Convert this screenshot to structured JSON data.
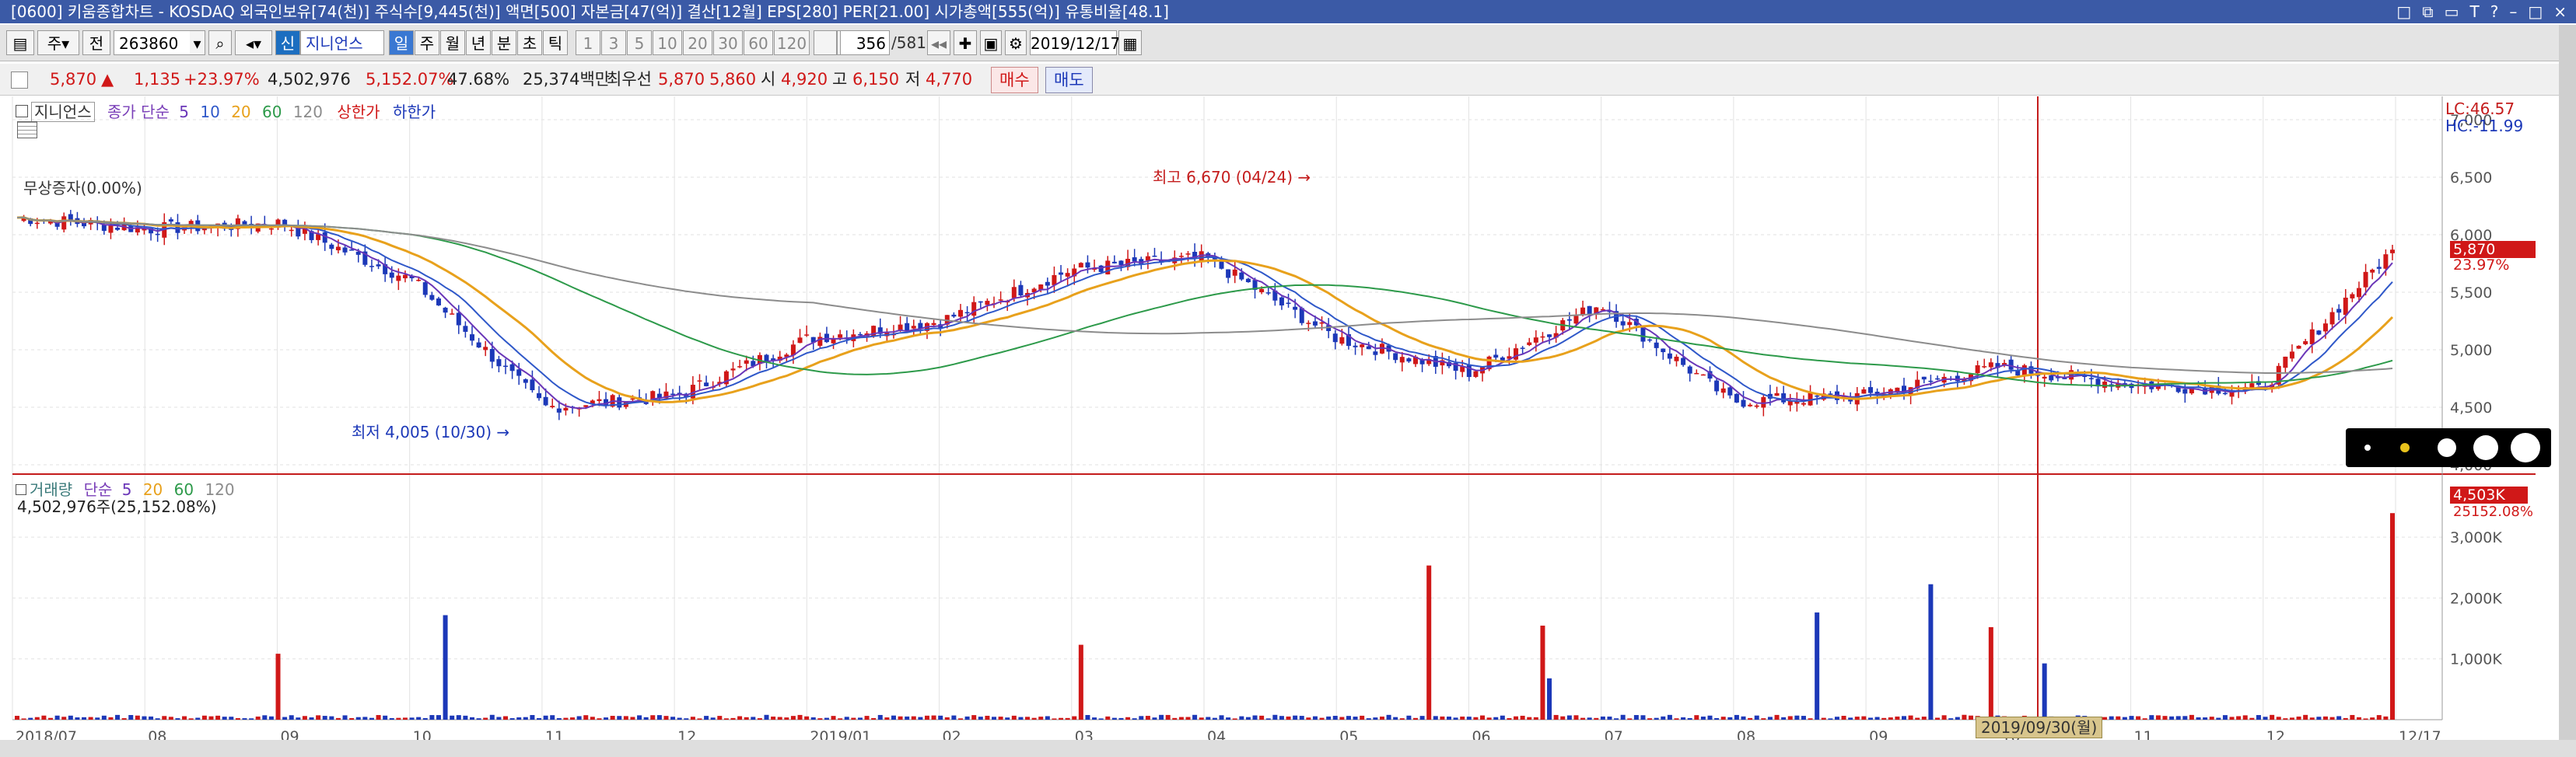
{
  "window": {
    "title": "[0600] 키움종합차트 - KOSDAQ 외국인보유[74(천)] 주식수[9,445(천)] 액면[500] 자본금[47(억)] 결산[12월] EPS[280] PER[21.00] 시가총액[555(억)] 유통비율[48.1]",
    "controls": [
      "□",
      "⧉",
      "▭",
      "T",
      "?",
      "–",
      "□",
      "×"
    ]
  },
  "toolbar": {
    "type_label": "주",
    "jeon_label": "전",
    "code": "263860",
    "stock_name": "지니언스",
    "shin_label": "신",
    "periods": [
      "일",
      "주",
      "월",
      "년",
      "분",
      "초",
      "틱"
    ],
    "minute_buttons": [
      "1",
      "3",
      "5",
      "10",
      "20",
      "30",
      "60",
      "120"
    ],
    "count": "356",
    "total": "/581",
    "date": "2019/12/17"
  },
  "info": {
    "price": "5,870",
    "arrow": "▲",
    "change": "1,135",
    "change_pct": "+23.97%",
    "volume": "4,502,976",
    "vol_ratio": "5,152.07%",
    "rate": "47.68%",
    "amount": "25,374백만",
    "best_label": "최우선",
    "ask": "5,870",
    "bid": "5,860",
    "open_label": "시",
    "open": "4,920",
    "high_label": "고",
    "high": "6,150",
    "low_label": "저",
    "low": "4,770",
    "buy_label": "매수",
    "sell_label": "매도"
  },
  "price_legend": {
    "name": "지니언스",
    "ma_label": "종가 단순",
    "ma": [
      "5",
      "10",
      "20",
      "60",
      "120"
    ],
    "upper": "상한가",
    "lower": "하한가",
    "no_increase": "무상증자(0.00%)",
    "high_note": "최고 6,670 (04/24) →",
    "low_note": "최저 4,005 (10/30) →",
    "lc": "LC:46.57",
    "hc": "HC:-11.99",
    "last_price_tag": "5,870",
    "last_pct_tag": "23.97%"
  },
  "volume_legend": {
    "title": "거래량",
    "ma_label": "단순",
    "ma": [
      "5",
      "20",
      "60",
      "120"
    ],
    "value": "4,502,976주(25,152.08%)",
    "last_tag": "4,503K",
    "last_pct_tag": "25152.08%"
  },
  "axes": {
    "price_ticks": [
      "7,000",
      "6,500",
      "6,000",
      "5,500",
      "5,000",
      "4,500",
      "4,000"
    ],
    "volume_ticks": [
      "3,000K",
      "2,000K",
      "1,000K"
    ],
    "x_labels": [
      "2018/07",
      "08",
      "09",
      "10",
      "11",
      "12",
      "2019/01",
      "02",
      "03",
      "04",
      "05",
      "06",
      "07",
      "08",
      "09",
      "10",
      "11",
      "12",
      "12/17"
    ],
    "cursor_date": "2019/09/30(월)"
  },
  "colors": {
    "up": "#d01818",
    "down": "#1c38b8",
    "ma5": "#6a36b8",
    "ma10": "#2f58c9",
    "ma20": "#e8a11c",
    "ma60": "#2d9a4a",
    "ma120": "#8c8c8c",
    "cursor": "#c41c1c",
    "title_bg": "#3b5aa6"
  },
  "chart_data": {
    "type": "line",
    "title": "",
    "xlabel": "",
    "ylabel": "",
    "x": [
      "2018/07",
      "08",
      "09",
      "10",
      "11",
      "12",
      "2019/01",
      "02",
      "03",
      "04",
      "05",
      "06",
      "07",
      "08",
      "09",
      "10",
      "11",
      "12",
      "12/17"
    ],
    "ylim": [
      4000,
      7000
    ],
    "series": [
      {
        "name": "종가",
        "values": [
          6150,
          6050,
          6100,
          5600,
          4500,
          4600,
          5100,
          5250,
          5700,
          5800,
          5100,
          4800,
          5400,
          4550,
          4600,
          4850,
          4700,
          4650,
          5870
        ]
      }
    ],
    "annotations": [
      "최고 6,670 (04/24)",
      "최저 4,005 (10/30)"
    ],
    "volume_ylim": [
      0,
      3500
    ],
    "volume_unit": "K"
  }
}
